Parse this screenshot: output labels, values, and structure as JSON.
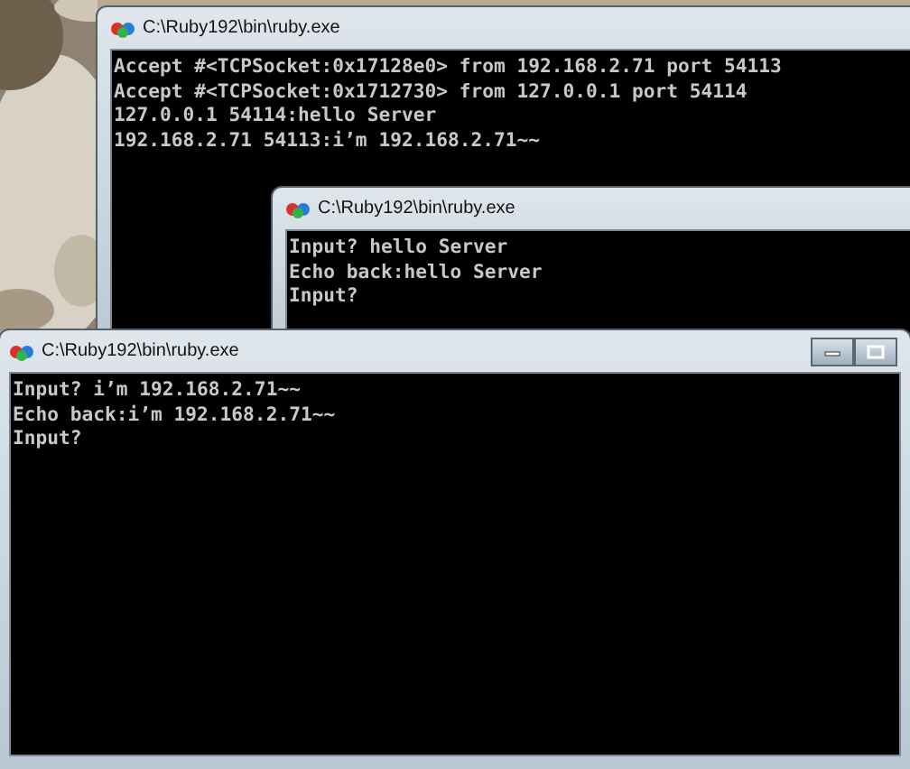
{
  "windows": [
    {
      "title": "C:\\Ruby192\\bin\\ruby.exe",
      "caption_buttons": false,
      "lines": [
        "Accept #<TCPSocket:0x17128e0> from 192.168.2.71 port 54113",
        "Accept #<TCPSocket:0x1712730> from 127.0.0.1 port 54114",
        "127.0.0.1 54114:hello Server",
        "192.168.2.71 54113:i’m 192.168.2.71~~"
      ]
    },
    {
      "title": "C:\\Ruby192\\bin\\ruby.exe",
      "caption_buttons": false,
      "lines": [
        "Input? hello Server",
        "Echo back:hello Server",
        "Input?"
      ]
    },
    {
      "title": "C:\\Ruby192\\bin\\ruby.exe",
      "caption_buttons": true,
      "lines": [
        "Input? i’m 192.168.2.71~~",
        "Echo back:i’m 192.168.2.71~~",
        "Input?"
      ]
    }
  ]
}
